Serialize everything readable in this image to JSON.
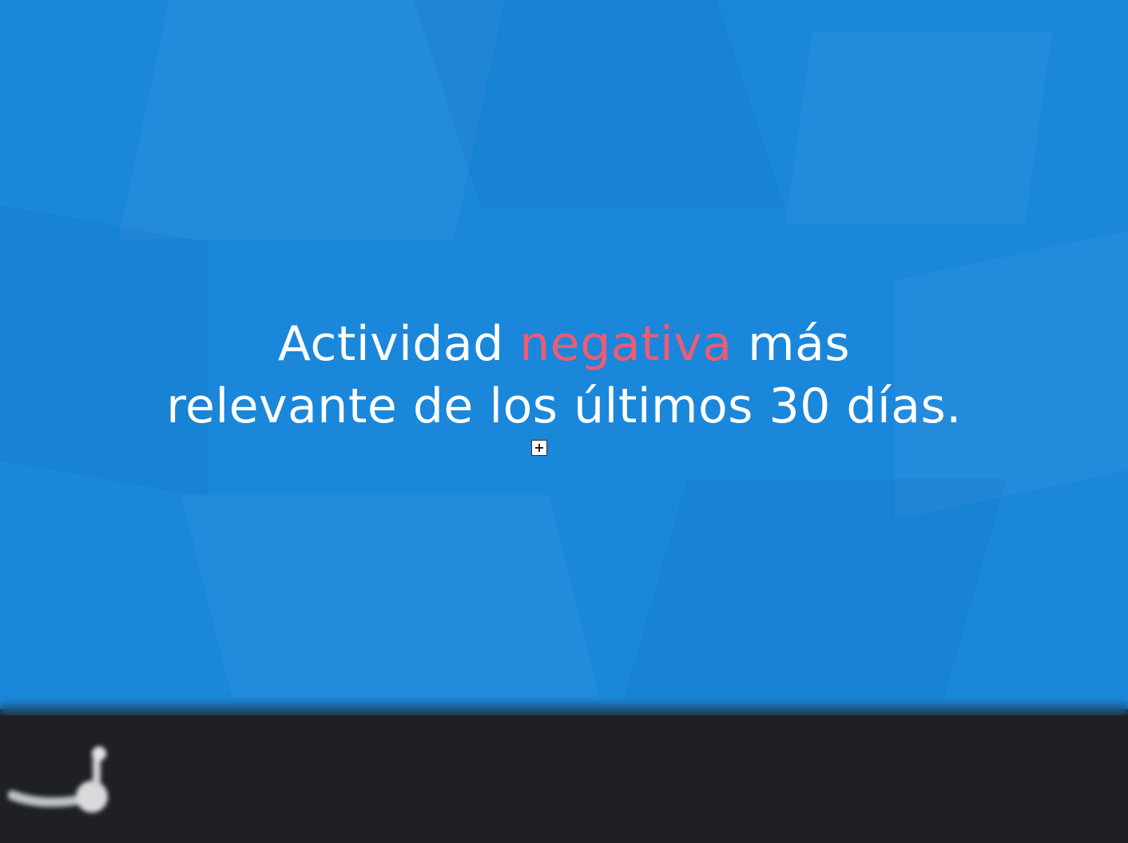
{
  "headline": {
    "line1_before": "Actividad ",
    "line1_accent": "negativa",
    "line1_after": " más",
    "line2": "relevante de los últimos 30 días."
  },
  "colors": {
    "background": "#1a87db",
    "accent": "#ee5b72",
    "text": "#ffffff",
    "footer": "#1e2023"
  },
  "icons": {
    "expand": "plus-square-icon",
    "logo": "brand-logo"
  }
}
